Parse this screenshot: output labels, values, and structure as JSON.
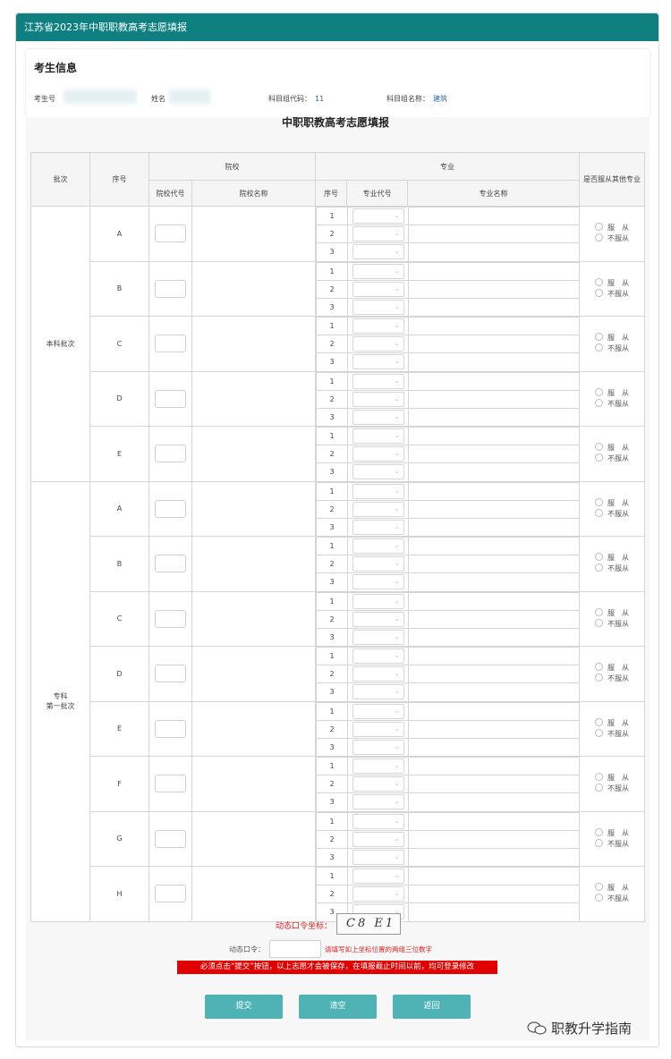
{
  "header": {
    "title": "江苏省2023年中职职教高考志愿填报"
  },
  "examinee": {
    "section_title": "考生信息",
    "id_label": "考生号",
    "name_label": "姓名",
    "group_code_label": "科目组代码：",
    "group_code_value": "11",
    "group_name_label": "科目组名称：",
    "group_name_value": "建筑"
  },
  "form": {
    "title": "中职职教高考志愿填报",
    "columns": {
      "batch": "批次",
      "seq": "序号",
      "school": "院校",
      "school_code": "院校代号",
      "school_name": "院校名称",
      "major": "专业",
      "major_seq": "序号",
      "major_code": "专业代号",
      "major_name": "专业名称",
      "obey": "是否服从其他专业"
    },
    "obey_options": [
      "服　从",
      "不服从"
    ],
    "major_rows": [
      "1",
      "2",
      "3"
    ],
    "groups": [
      {
        "label": "本科批次",
        "letters": [
          "A",
          "B",
          "C",
          "D",
          "E"
        ]
      },
      {
        "label": "专科\n第一批次",
        "letters": [
          "A",
          "B",
          "C",
          "D",
          "E",
          "F",
          "G",
          "H"
        ]
      }
    ]
  },
  "captcha": {
    "label": "动态口令坐标：",
    "image_text": "C8 E1",
    "input_label": "动态口令：",
    "hint": "请填写如上坐标位置的两组三位数字"
  },
  "warning": "必须点击“提交”按钮，以上志愿才会被保存，在填报截止时间以前，均可登录修改",
  "buttons": {
    "submit": "提交",
    "clear": "清空",
    "back": "返回"
  },
  "watermark": "职教升学指南"
}
